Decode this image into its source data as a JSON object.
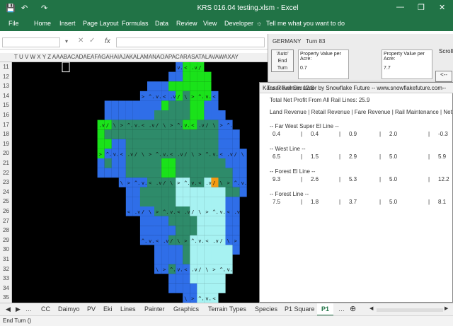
{
  "window": {
    "title": "KRS 016.04 testing.xlsm  -  Excel",
    "minimize": "—",
    "restore": "❐",
    "close": "✕"
  },
  "quick_access": {
    "save": "💾",
    "undo": "↶",
    "redo": "↷"
  },
  "ribbon": {
    "tabs": [
      "File",
      "Home",
      "Insert",
      "Page Layout",
      "Formulas",
      "Data",
      "Review",
      "View",
      "Developer"
    ],
    "tell_me": "Tell me what you want to do"
  },
  "formula_bar": {
    "fx": "fx"
  },
  "columns": "T  U  V  W  X  Y  Z  AAABACADAEAFAGAHAIAJAKALAMANAOAPACARASATALAVAWAXAY",
  "rows": [
    "11",
    "12",
    "13",
    "14",
    "15",
    "16",
    "17",
    "18",
    "19",
    "20",
    "21",
    "22",
    "23",
    "24",
    "25",
    "26",
    "27",
    "28",
    "29",
    "30",
    "31",
    "32",
    "33",
    "34",
    "35"
  ],
  "panel": {
    "country": "GERMANY",
    "turn": "Turn 83",
    "auto_button": [
      "'Auto'",
      "End",
      "Turn"
    ],
    "property_1": {
      "label": "Property Value per Acre:",
      "value": "0.7"
    },
    "property_2": {
      "label": "Property Value per Acre:",
      "value": "7.7"
    },
    "scroll_label": "Scroll",
    "arrow": "<--"
  },
  "report": {
    "title": "Kansai Rail Simulator by Snowflake Future -- www.snowflakefuture.com--",
    "tax_revenue": "Tax Revenue: 12.0",
    "total_profit": "Total Net Profit From All Rail Lines: 25.9",
    "columns_header": "Land Revenue | Retail Revenue | Fare Revenue | Rail Maintenance | Net Profit",
    "lines": [
      {
        "name": "-- Far West Super El Line --",
        "values": [
          "0.4",
          "0.4",
          "0.9",
          "2.0",
          "-0.3"
        ]
      },
      {
        "name": "-- West Line --",
        "values": [
          "6.5",
          "1.5",
          "2.9",
          "5.0",
          "5.9"
        ]
      },
      {
        "name": "-- Forest El Line --",
        "values": [
          "9.3",
          "2.6",
          "5.3",
          "5.0",
          "12.2"
        ]
      },
      {
        "name": "-- Forest Line --",
        "values": [
          "7.5",
          "1.8",
          "3.7",
          "5.0",
          "8.1"
        ]
      }
    ]
  },
  "sheet_tabs": [
    "CC",
    "Daimyo",
    "PV",
    "Eki",
    "Lines",
    "Painter",
    "Graphics",
    "Terrain Types",
    "Species",
    "P1 Square",
    "P1"
  ],
  "active_sheet": "P1",
  "status_text": "End Turn ()",
  "map": {
    "colors": {
      "blue": "#2f6ee8",
      "green": "#1ae21a",
      "teal": "#2e8b6a",
      "cyan": "#a7f2f2",
      "orange": "#f39a13",
      "black": "#000000"
    },
    "rows": [
      ".......................bggg.........",
      "......................bbgggg........",
      "...................bbbgggggg........",
      "..................bbbbbgtgggb.......",
      ".............bbbbbbbbgtttggbb.......",
      ".............bbbbbbbtttttggbbb......",
      "............ggttttttttttggtttbb.....",
      "............gttttttttttttttttbbb....",
      "............ggbbtttttttttttttbbb....",
      "............gbbbtttttttttttttbbbb...",
      "............btbbtttttggtttttttbbb...",
      "............bbbbtttttggttttttttbb...",
      "...............bbbbttttccttcottbb...",
      "................bbtttttcccccccttb....",
      "................bbtttttcccccccbb....",
      "................bbbbtttttcccccbb....",
      "..................bbbbttttccccbb....",
      "..................bbbbbtttccccbb....",
      "..................bbbbtttcccccbb....",
      "....................bbbbtccccccb....",
      "....................bbbbtcccccc.....",
      "....................bbtbbcccccc.....",
      "......................bbbccccc......",
      "......................bbbbcccc......",
      "........................bbccc......."
    ]
  }
}
